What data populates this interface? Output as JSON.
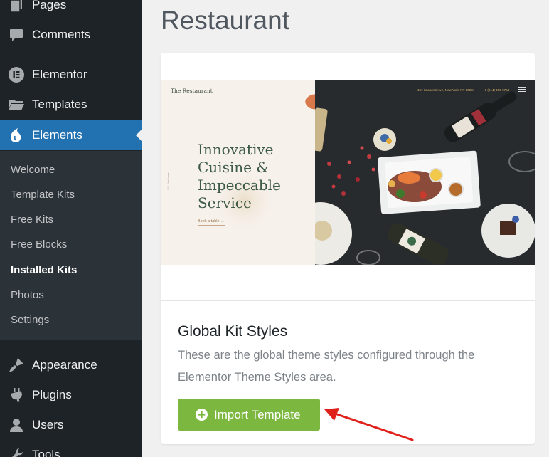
{
  "sidebar": {
    "items": [
      {
        "label": "Pages",
        "icon": "pages-icon"
      },
      {
        "label": "Comments",
        "icon": "comments-icon"
      },
      {
        "label": "Elementor",
        "icon": "elementor-icon"
      },
      {
        "label": "Templates",
        "icon": "folder-icon"
      },
      {
        "label": "Elements",
        "icon": "elements-icon"
      },
      {
        "label": "Appearance",
        "icon": "brush-icon"
      },
      {
        "label": "Plugins",
        "icon": "plugin-icon"
      },
      {
        "label": "Users",
        "icon": "user-icon"
      },
      {
        "label": "Tools",
        "icon": "wrench-icon"
      }
    ],
    "submenu": [
      {
        "label": "Welcome"
      },
      {
        "label": "Template Kits"
      },
      {
        "label": "Free Kits"
      },
      {
        "label": "Free Blocks"
      },
      {
        "label": "Installed Kits"
      },
      {
        "label": "Photos"
      },
      {
        "label": "Settings"
      }
    ],
    "active_item": "Elements",
    "current_subitem": "Installed Kits"
  },
  "main": {
    "page_title": "Restaurant",
    "card": {
      "preview": {
        "logo": "The Restaurant",
        "headline_lines": [
          "Innovative",
          "Cuisine &",
          "Impeccable",
          "Service"
        ],
        "cta": "Book a table →",
        "side_text": "01 · Welcome",
        "nav_text": "157 Seasonal Ave, New York, NY 10084",
        "phone": "+1 (914) 466-9764"
      },
      "title": "Global Kit Styles",
      "description": "These are the global theme styles configured through the Elementor Theme Styles area.",
      "button_label": "Import Template",
      "button_icon": "plus-circle-icon"
    }
  },
  "colors": {
    "sidebar_bg": "#1d2327",
    "submenu_bg": "#2c3338",
    "active_bg": "#2271b1",
    "button_bg": "#7cb83f",
    "annotation_arrow": "#e0221c"
  }
}
